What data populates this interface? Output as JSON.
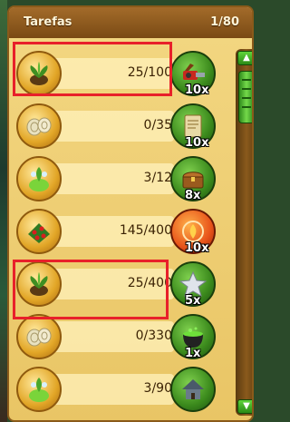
{
  "header": {
    "title": "Tarefas",
    "count": "1/80"
  },
  "tasks": [
    {
      "progress": "25/100",
      "resource_icon": "plant-seedling-icon",
      "reward_icon": "chainsaw-icon",
      "reward_mult": "10x"
    },
    {
      "progress": "0/35",
      "resource_icon": "cut-wood-icon",
      "reward_icon": "recipe-scroll-icon",
      "reward_mult": "10x"
    },
    {
      "progress": "3/12",
      "resource_icon": "gem-plant-icon",
      "reward_icon": "treasure-chest-icon",
      "reward_mult": "8x"
    },
    {
      "progress": "145/400",
      "resource_icon": "berry-bush-icon",
      "reward_icon": "fire-orb-icon",
      "reward_mult": "10x"
    },
    {
      "progress": "25/400",
      "resource_icon": "plant-seedling-icon",
      "reward_icon": "silver-star-icon",
      "reward_mult": "5x"
    },
    {
      "progress": "0/330",
      "resource_icon": "cut-wood-icon",
      "reward_icon": "cauldron-icon",
      "reward_mult": "1x"
    },
    {
      "progress": "3/90",
      "resource_icon": "gem-plant-icon",
      "reward_icon": "house-icon",
      "reward_mult": ""
    }
  ],
  "colors": {
    "highlight": "#e8202a",
    "panel": "#f0d27a",
    "header": "#8f5a1e"
  }
}
